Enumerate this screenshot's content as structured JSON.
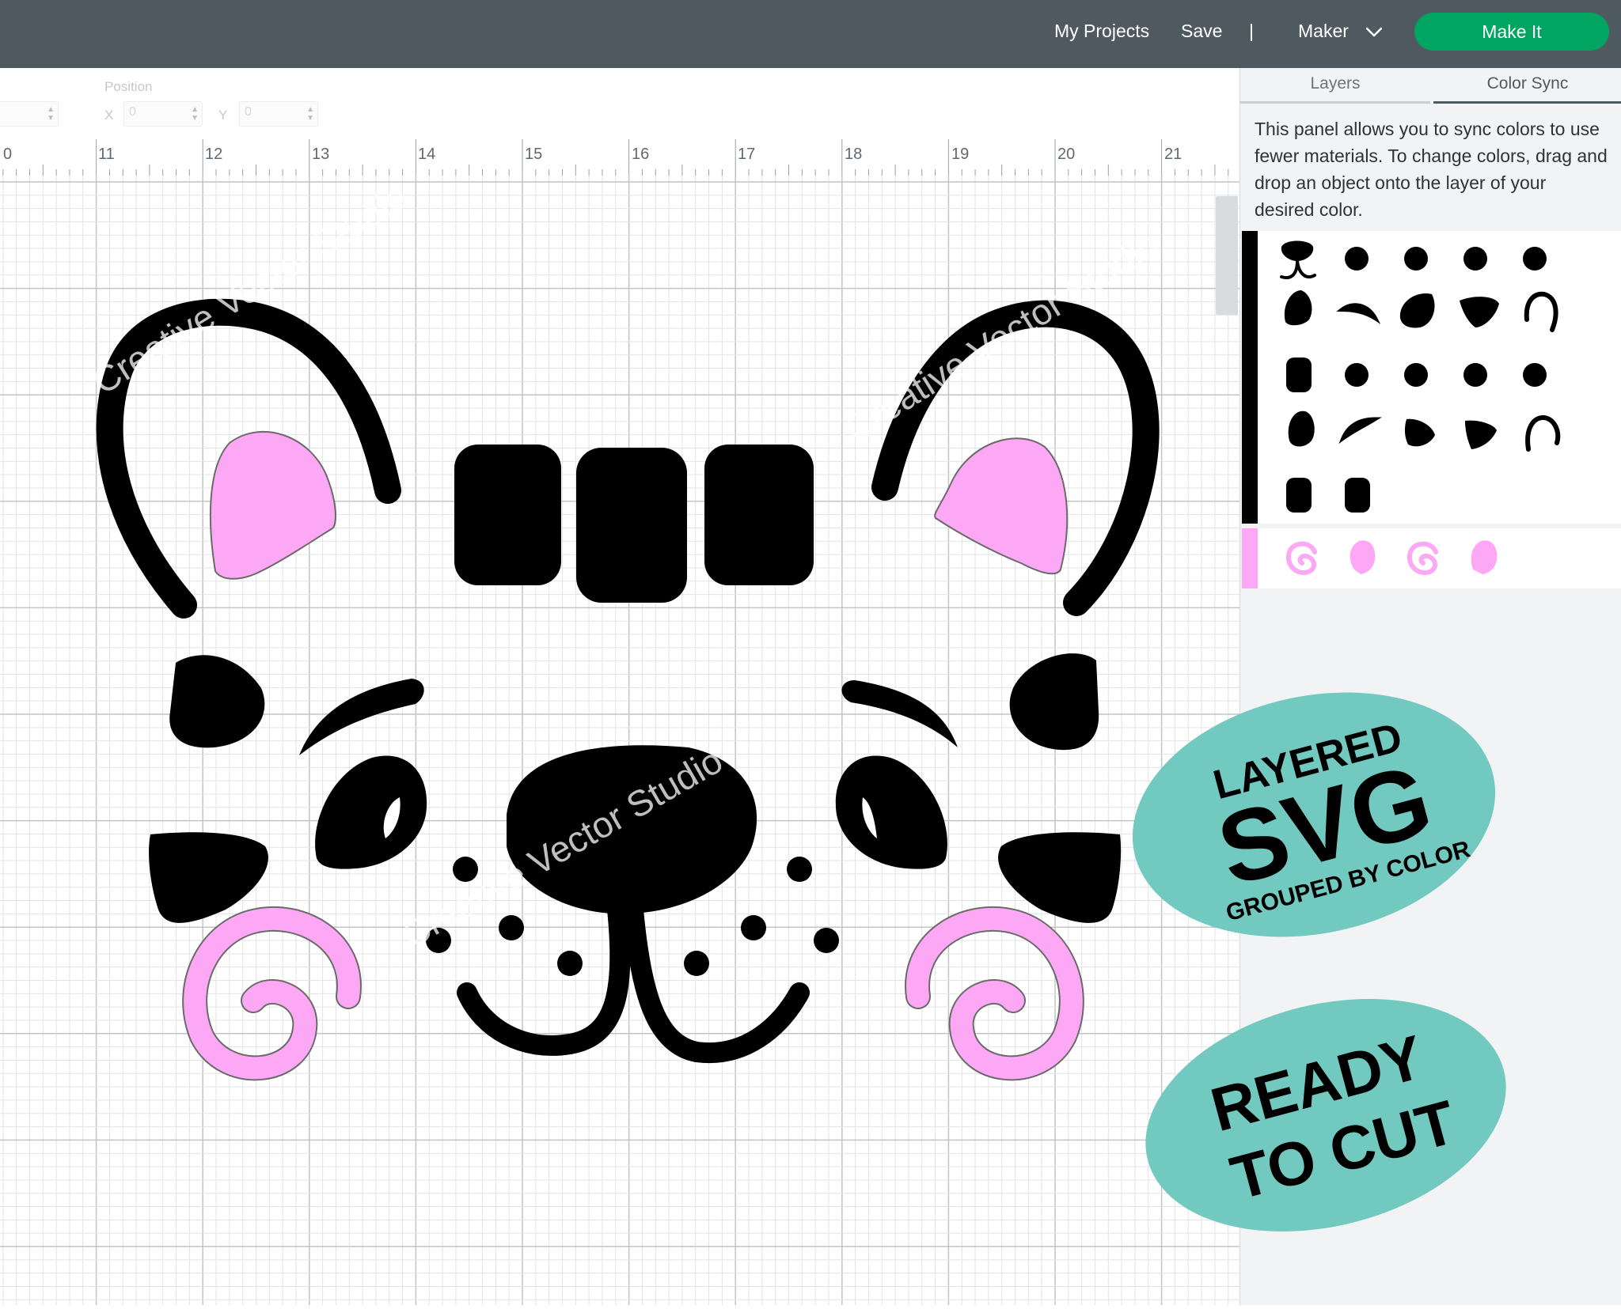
{
  "topbar": {
    "my_projects": "My Projects",
    "save": "Save",
    "separator": "|",
    "maker": "Maker",
    "make_it": "Make It",
    "make_it_color": "#00a562",
    "bar_color": "#4f5960"
  },
  "position_toolbar": {
    "label": "Position",
    "x_label": "X",
    "y_label": "Y",
    "x_value": "0",
    "y_value": "0"
  },
  "ruler": {
    "ticks": [
      "0",
      "11",
      "12",
      "13",
      "14",
      "15",
      "16",
      "17",
      "18",
      "19",
      "20",
      "21"
    ]
  },
  "panel": {
    "tabs": [
      "Layers",
      "Color Sync"
    ],
    "active_tab": "Color Sync",
    "description": "This panel allows you to sync colors to use fewer materials. To change colors, drag and drop an object onto the layer of your desired color.",
    "groups": [
      {
        "color": "#000000",
        "item_count": 22
      },
      {
        "color": "#fda8f4",
        "item_count": 4
      }
    ]
  },
  "watermark": "Creative Vector Studio",
  "badges": {
    "layered": "LAYERED",
    "svg": "SVG",
    "grouped": "GROUPED BY COLOR",
    "ready": "READY",
    "to_cut": "TO CUT",
    "color": "#72c9bf"
  },
  "colors": {
    "black": "#000000",
    "pink": "#fda8f4",
    "grid_minor": "#e3e3e3",
    "grid_major": "#c4c4c4"
  }
}
